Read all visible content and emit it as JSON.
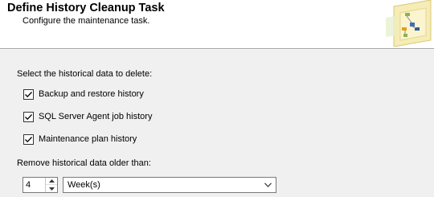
{
  "header": {
    "title": "Define History Cleanup Task",
    "subtitle": "Configure the maintenance task."
  },
  "icons": {
    "wizard": "maintenance-wizard-icon",
    "checkbox_mark": "checkmark-icon",
    "spin_up": "arrow-up-icon",
    "spin_down": "arrow-down-icon",
    "dropdown": "chevron-down-icon"
  },
  "options": {
    "label": "Select the historical data to delete:",
    "items": [
      {
        "label": "Backup and restore history",
        "checked": true
      },
      {
        "label": "SQL Server Agent job history",
        "checked": true
      },
      {
        "label": "Maintenance plan history",
        "checked": true
      }
    ]
  },
  "retention": {
    "label": "Remove historical data older than:",
    "amount": "4",
    "unit": "Week(s)"
  },
  "colors": {
    "header_bg": "#ffffff",
    "body_bg": "#f0f0f0",
    "control_border": "#7a7a7a"
  }
}
